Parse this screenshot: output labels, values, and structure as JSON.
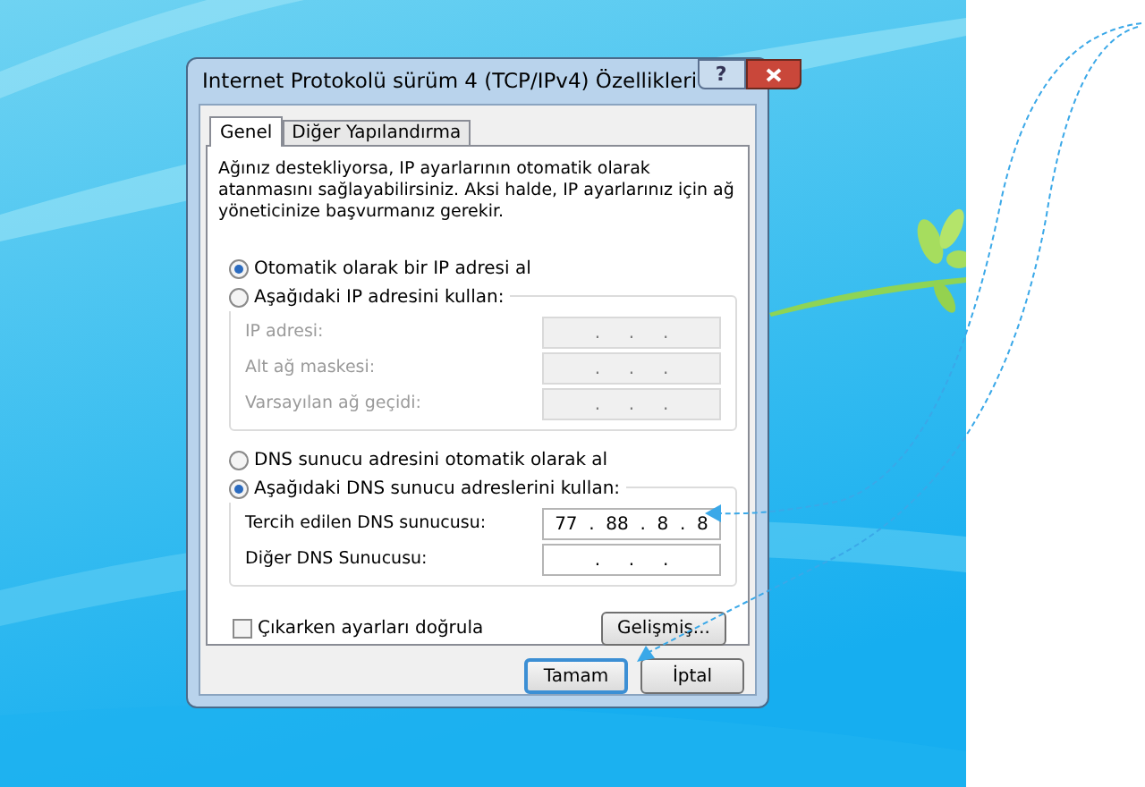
{
  "window": {
    "title": "Internet Protokolü sürüm 4 (TCP/IPv4) Özellikleri",
    "help_button": "?"
  },
  "tabs": [
    {
      "label": "Genel",
      "selected": true
    },
    {
      "label": "Diğer Yapılandırma",
      "selected": false
    }
  ],
  "description": "Ağınız destekliyorsa, IP ayarlarının otomatik olarak atanmasını sağlayabilirsiniz. Aksi halde, IP ayarlarınız için ağ yöneticinize başvurmanız gerekir.",
  "ip_options": [
    {
      "label": "Otomatik olarak bir IP adresi al",
      "selected": true
    },
    {
      "label": "Aşağıdaki IP adresini kullan:",
      "selected": false
    }
  ],
  "ip_fields": [
    {
      "label": "IP adresi:",
      "value": ".     .     .",
      "disabled": true
    },
    {
      "label": "Alt ağ maskesi:",
      "value": ".     .     .",
      "disabled": true
    },
    {
      "label": "Varsayılan ağ geçidi:",
      "value": ".     .     .",
      "disabled": true
    }
  ],
  "dns_options": [
    {
      "label": "DNS sunucu adresini otomatik olarak al",
      "selected": false
    },
    {
      "label": "Aşağıdaki DNS sunucu adreslerini kullan:",
      "selected": true
    }
  ],
  "dns_fields": [
    {
      "label": "Tercih edilen DNS sunucusu:",
      "value": "77  .  88  .  8  .  8",
      "disabled": false
    },
    {
      "label": "Diğer DNS Sunucusu:",
      "value": ".     .     .",
      "disabled": false
    }
  ],
  "validate_checkbox": {
    "label": "Çıkarken ayarları doğrula",
    "checked": false
  },
  "advanced_button": "Gelişmiş...",
  "buttons": [
    {
      "label": "Tamam",
      "default": true
    },
    {
      "label": "İptal",
      "default": false
    }
  ]
}
